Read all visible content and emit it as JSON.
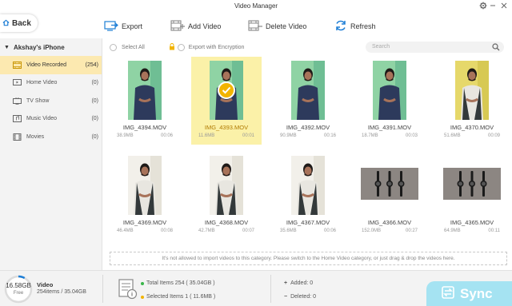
{
  "window": {
    "title": "Video Manager",
    "settings_icon": "gear-icon",
    "minimize_icon": "minus-icon",
    "close_icon": "close-icon"
  },
  "back": {
    "label": "Back",
    "icon": "home-icon"
  },
  "toolbar": {
    "export_label": "Export",
    "add_label": "Add Video",
    "delete_label": "Delete Video",
    "refresh_label": "Refresh"
  },
  "sidebar": {
    "device": "Akshay's iPhone",
    "items": [
      {
        "label": "Video Recorded",
        "count": "(254)",
        "icon": "video-icon",
        "active": true
      },
      {
        "label": "Home Video",
        "count": "(0)",
        "icon": "home-video-icon",
        "active": false
      },
      {
        "label": "TV Show",
        "count": "(0)",
        "icon": "tv-icon",
        "active": false
      },
      {
        "label": "Music Video",
        "count": "(0)",
        "icon": "music-video-icon",
        "active": false
      },
      {
        "label": "Movies",
        "count": "(0)",
        "icon": "movie-icon",
        "active": false
      }
    ]
  },
  "content": {
    "select_all": "Select All",
    "export_encryption": "Export with Encryption",
    "search_placeholder": "Search",
    "notice": "It's not allowed to  import videos to this category.  Please switch to the Home Video category, or just drag & drop the videos here."
  },
  "videos": [
    {
      "name": "IMG_4394.MOV",
      "size": "38.9MB",
      "duration": "00:06",
      "selected": false,
      "kind": "person",
      "bg": "green"
    },
    {
      "name": "IMG_4393.MOV",
      "size": "11.6MB",
      "duration": "00:01",
      "selected": true,
      "kind": "person",
      "bg": "green"
    },
    {
      "name": "IMG_4392.MOV",
      "size": "90.9MB",
      "duration": "00:16",
      "selected": false,
      "kind": "person",
      "bg": "green"
    },
    {
      "name": "IMG_4391.MOV",
      "size": "18.7MB",
      "duration": "00:03",
      "selected": false,
      "kind": "person",
      "bg": "green"
    },
    {
      "name": "IMG_4370.MOV",
      "size": "51.6MB",
      "duration": "00:09",
      "selected": false,
      "kind": "person-vest",
      "bg": "yellow"
    },
    {
      "name": "IMG_4369.MOV",
      "size": "46.4MB",
      "duration": "00:08",
      "selected": false,
      "kind": "person-vest",
      "bg": "white"
    },
    {
      "name": "IMG_4368.MOV",
      "size": "42.7MB",
      "duration": "00:07",
      "selected": false,
      "kind": "person-vest",
      "bg": "white"
    },
    {
      "name": "IMG_4367.MOV",
      "size": "35.6MB",
      "duration": "00:06",
      "selected": false,
      "kind": "person-vest",
      "bg": "white"
    },
    {
      "name": "IMG_4366.MOV",
      "size": "152.0MB",
      "duration": "00:27",
      "selected": false,
      "kind": "watches",
      "bg": "gray"
    },
    {
      "name": "IMG_4365.MOV",
      "size": "64.9MB",
      "duration": "00:11",
      "selected": false,
      "kind": "watches",
      "bg": "gray"
    }
  ],
  "storage": {
    "free_size": "16.58GB",
    "free_label": "Free",
    "title": "Video",
    "summary": "254items / 35.04GB",
    "used_fraction": 0.08
  },
  "stats": {
    "total": "Total Items 254  ( 35.04GB )",
    "selected": "Selected Items 1  ( 11.6MB )",
    "added": "Added:  0",
    "deleted": "Deleted:  0"
  },
  "sync": {
    "label": "Sync"
  },
  "colors": {
    "accent": "#f2b400",
    "active_bg": "#fce9b0",
    "selected_tile": "#fbf1a8",
    "toolbar_icon": "#1d7ed6",
    "sync_bg": "#a5e3f2",
    "total_dot": "#39b54a",
    "selected_dot": "#f2b400"
  }
}
